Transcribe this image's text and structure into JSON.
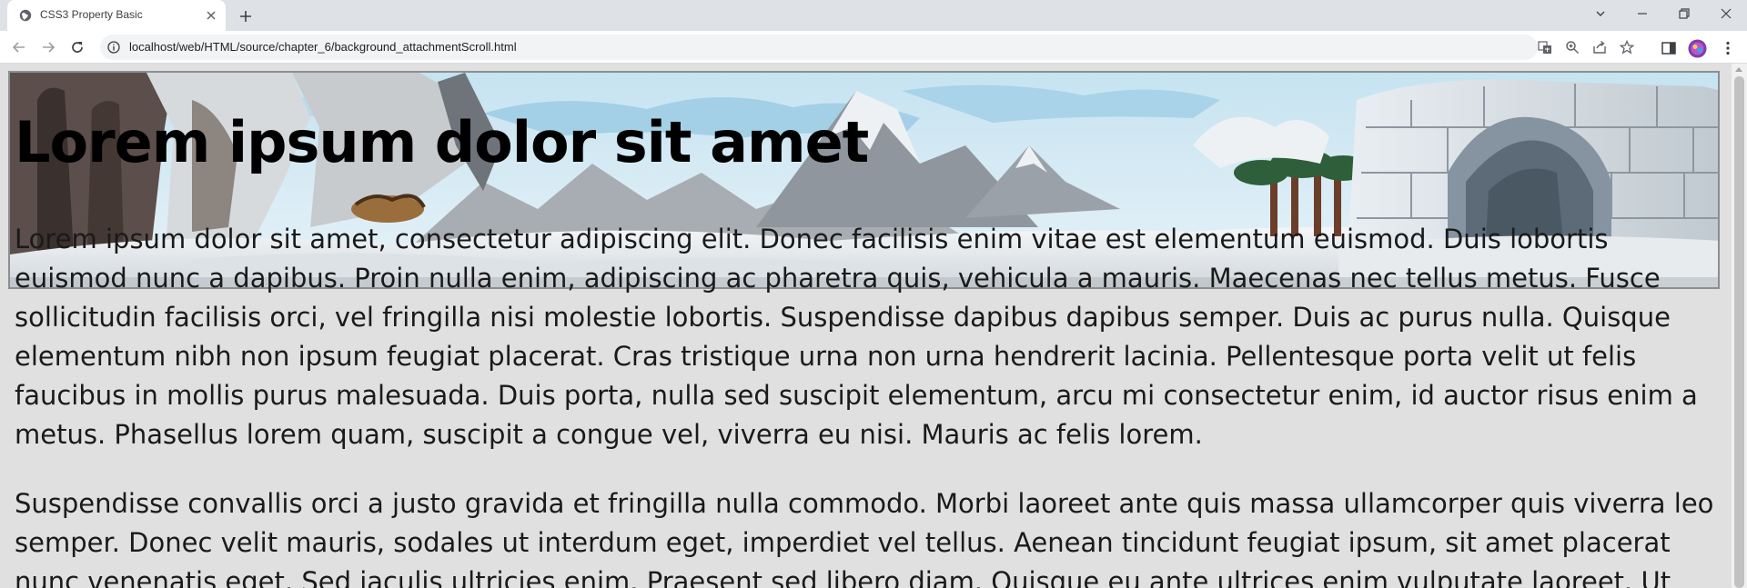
{
  "browser": {
    "tab_title": "CSS3 Property Basic",
    "url": "localhost/web/HTML/source/chapter_6/background_attachmentScroll.html",
    "icons": [
      "favicon-globe-icon",
      "close-tab-icon",
      "new-tab-icon",
      "back-icon",
      "forward-icon",
      "reload-icon",
      "info-icon",
      "translate-icon",
      "zoom-icon",
      "share-icon",
      "bookmark-star-icon",
      "side-panel-icon",
      "profile-avatar-icon",
      "menu-kebab-icon",
      "tab-search-icon",
      "minimize-icon",
      "restore-icon",
      "close-window-icon"
    ]
  },
  "page": {
    "heading": "Lorem ipsum dolor sit amet",
    "paragraph1": "Lorem ipsum dolor sit amet, consectetur adipiscing elit. Donec facilisis enim vitae est elementum euismod. Duis lobortis euismod nunc a dapibus. Proin nulla enim, adipiscing ac pharetra quis, vehicula a mauris. Maecenas nec tellus metus. Fusce sollicitudin facilisis orci, vel fringilla nisi molestie lobortis. Suspendisse dapibus dapibus semper. Duis ac purus nulla. Quisque elementum nibh non ipsum feugiat placerat. Cras tristique urna non urna hendrerit lacinia. Pellentesque porta velit ut felis faucibus in mollis purus malesuada. Duis porta, nulla sed suscipit elementum, arcu mi consectetur enim, id auctor risus enim a metus. Phasellus lorem quam, suscipit a congue vel, viverra eu nisi. Mauris ac felis lorem.",
    "paragraph2": "Suspendisse convallis orci a justo gravida et fringilla nulla commodo. Morbi laoreet ante quis massa ullamcorper quis viverra leo semper. Donec velit mauris, sodales ut interdum eget, imperdiet vel tellus. Aenean tincidunt feugiat ipsum, sit amet placerat nunc venenatis eget. Sed iaculis ultricies enim. Praesent sed libero diam. Quisque eu ante ultrices enim vulputate laoreet. Ut"
  },
  "colors": {
    "page_background": "#e0e0e0",
    "tabstrip": "#dee1e6",
    "sky": "#a9d3e8"
  }
}
